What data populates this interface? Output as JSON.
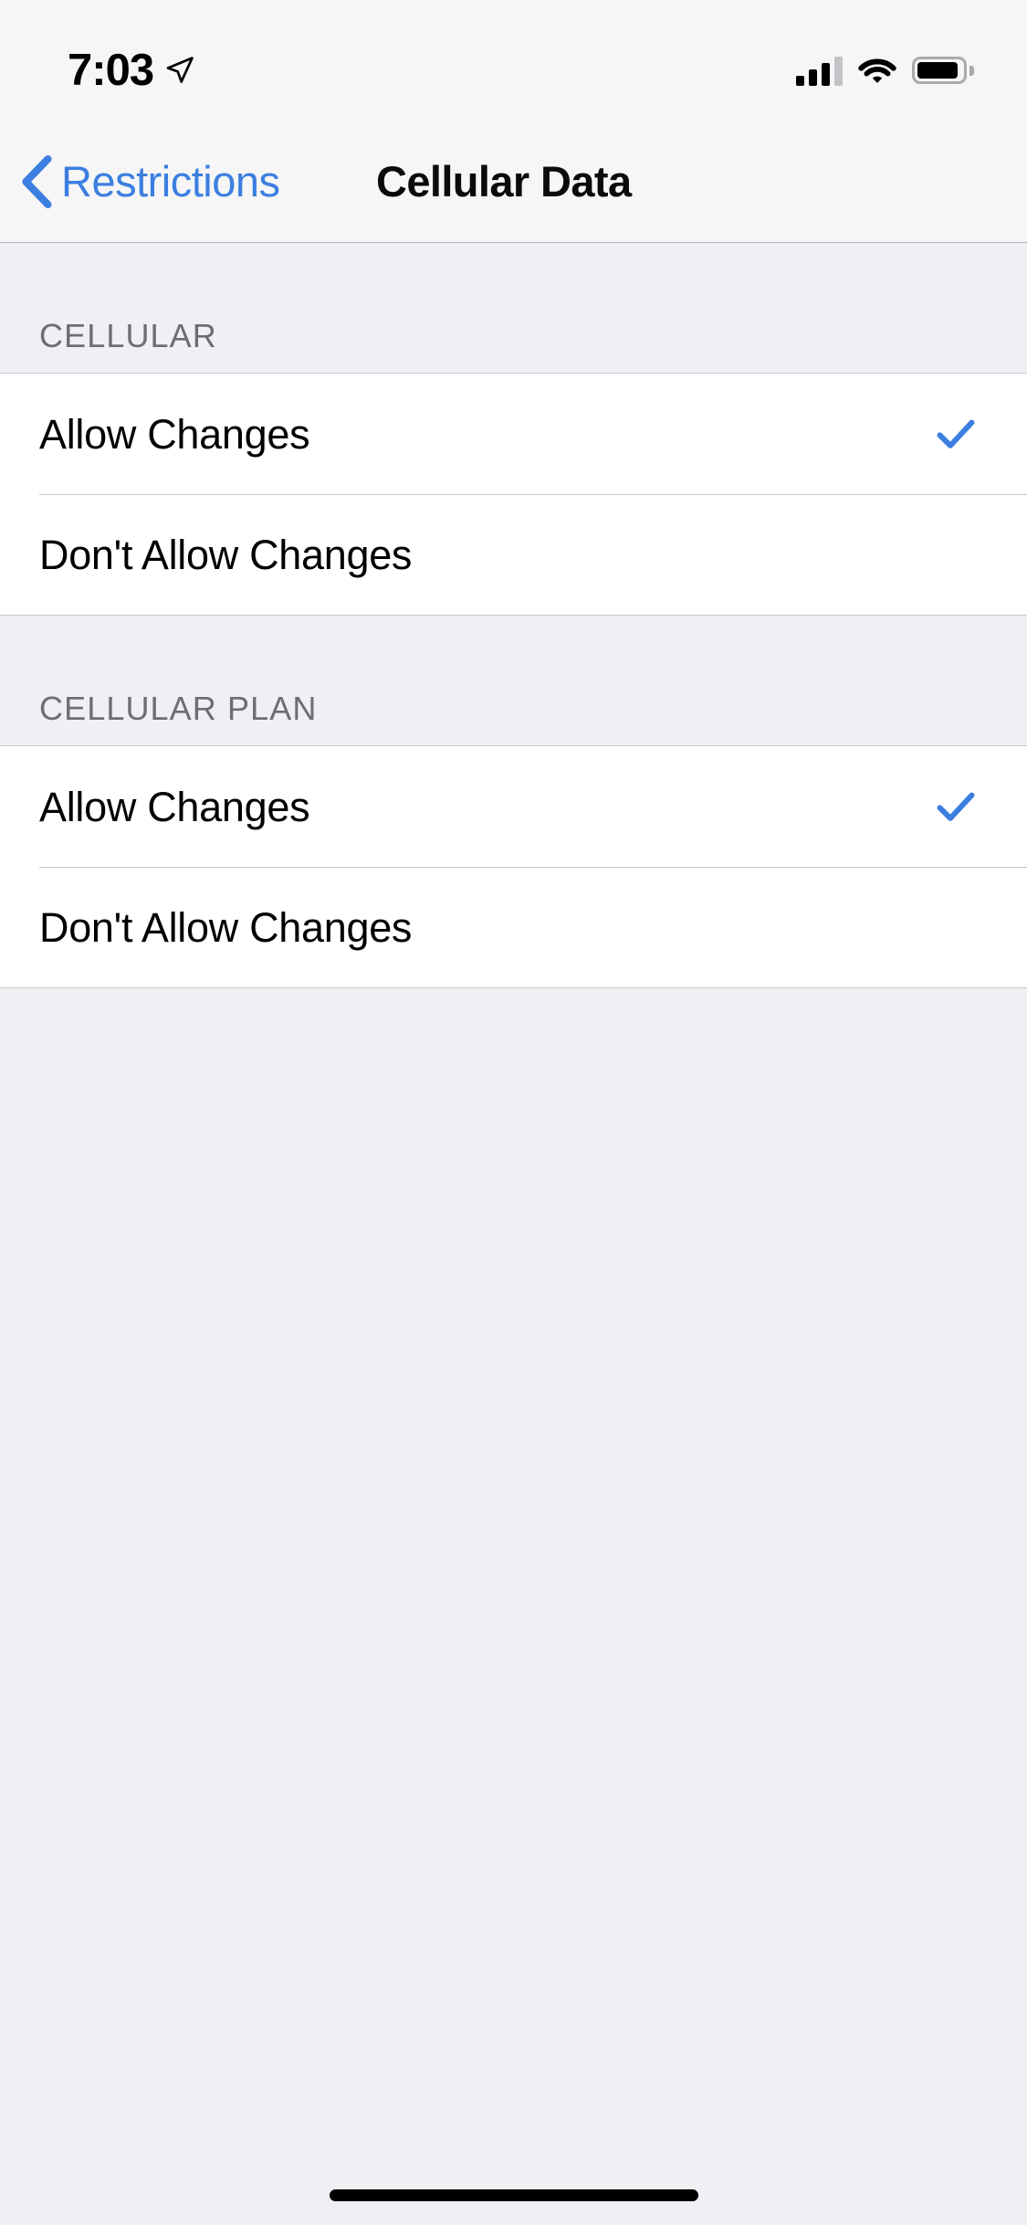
{
  "status_bar": {
    "time": "7:03",
    "location_icon": "location-arrow-icon",
    "signal_icon": "cellular-signal-icon",
    "signal_bars_filled": 3,
    "signal_bars_total": 4,
    "wifi_icon": "wifi-icon",
    "battery_icon": "battery-icon",
    "battery_level_percent": 92
  },
  "nav_bar": {
    "back_label": "Restrictions",
    "back_icon": "chevron-left-icon",
    "title": "Cellular Data"
  },
  "sections": [
    {
      "header": "CELLULAR",
      "rows": [
        {
          "label": "Allow Changes",
          "checked": true
        },
        {
          "label": "Don't Allow Changes",
          "checked": false
        }
      ]
    },
    {
      "header": "CELLULAR PLAN",
      "rows": [
        {
          "label": "Allow Changes",
          "checked": true
        },
        {
          "label": "Don't Allow Changes",
          "checked": false
        }
      ]
    }
  ],
  "colors": {
    "accent_blue": "#3C7FE0",
    "check_blue": "#3C7FE0",
    "background": "#EFEFF4",
    "bar_background": "#F6F6F7",
    "row_background": "#FFFFFF",
    "separator": "#C8C7CC",
    "header_text": "#6D6D72"
  },
  "home_indicator": "home-indicator"
}
